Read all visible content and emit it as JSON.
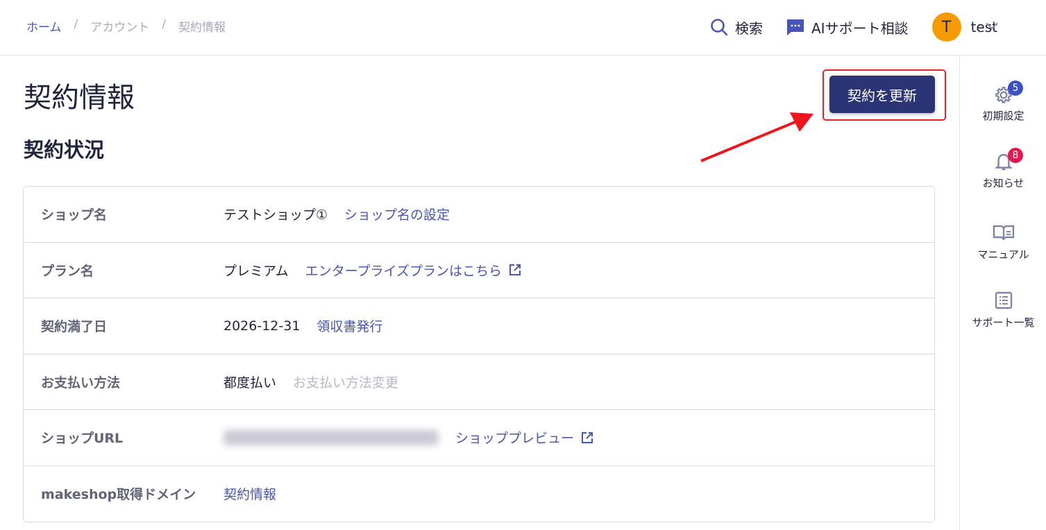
{
  "breadcrumb": [
    "ホーム",
    "/",
    "アカウント",
    "/",
    "契約情報"
  ],
  "header": {
    "search": "検索",
    "ai_support": "AIサポート相談",
    "avatar_initial": "T",
    "user": "test"
  },
  "rail": [
    {
      "label": "初期設定",
      "badge": "5",
      "icon": "gear-icon",
      "badge_color": "#3d4fc4"
    },
    {
      "label": "お知らせ",
      "badge": "8",
      "icon": "bell-icon",
      "badge_color": "#e5174f"
    },
    {
      "label": "マニュアル",
      "icon": "book-icon"
    },
    {
      "label": "サポート一覧",
      "icon": "list-icon"
    }
  ],
  "page_title": "契約情報",
  "update_button": "契約を更新",
  "section_title": "契約状況",
  "rows": [
    {
      "label": "ショップ名",
      "value": "テストショップ①",
      "link": "ショップ名の設定"
    },
    {
      "label": "プラン名",
      "value": "プレミアム",
      "link": "エンタープライズプランはこちら"
    },
    {
      "label": "契約満了日",
      "value": "2026-12-31",
      "link": "領収書発行"
    },
    {
      "label": "お支払い方法",
      "value": "都度払い",
      "link": "お支払い方法変更"
    },
    {
      "label": "ショップURL",
      "link": "ショッププレビュー"
    },
    {
      "label": "makeshop取得ドメイン",
      "link": "契約情報"
    }
  ]
}
